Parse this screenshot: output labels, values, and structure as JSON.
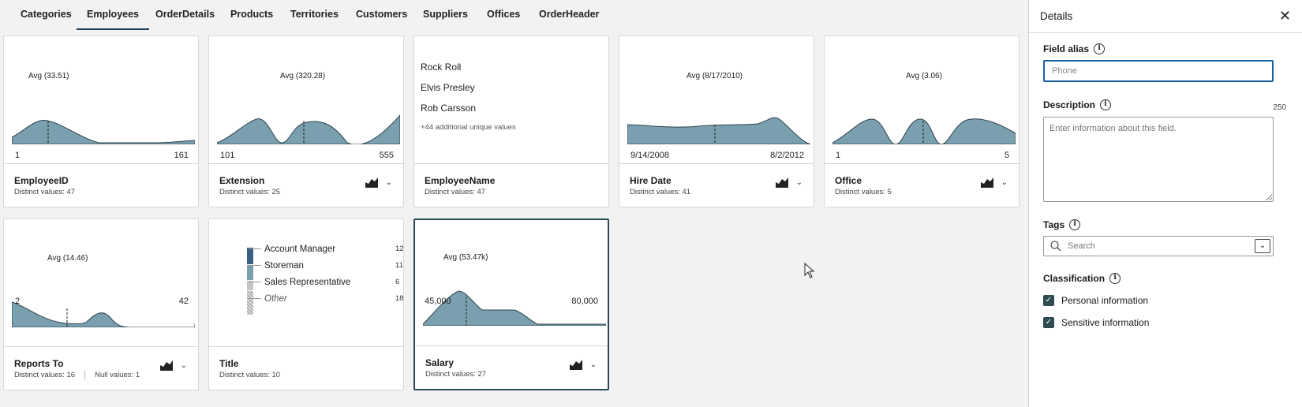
{
  "tabs": [
    "Categories",
    "Employees",
    "OrderDetails",
    "Products",
    "Territories",
    "Customers",
    "Suppliers",
    "Offices",
    "OrderHeader"
  ],
  "active_tab": "Employees",
  "cards": {
    "employee_id": {
      "name": "EmployeeID",
      "distinct": "Distinct values: 47",
      "avg": "Avg (33.51)",
      "min": "1",
      "max": "161"
    },
    "extension": {
      "name": "Extension",
      "distinct": "Distinct values: 25",
      "avg": "Avg (320.28)",
      "min": "101",
      "max": "555"
    },
    "employee_name": {
      "name": "EmployeeName",
      "distinct": "Distinct values: 47",
      "values": [
        "Rock Roll",
        "Elvis Presley",
        "Rob Carsson"
      ],
      "more": "+44 additional unique values"
    },
    "hire_date": {
      "name": "Hire Date",
      "distinct": "Distinct values: 41",
      "avg": "Avg (8/17/2010)",
      "min": "9/14/2008",
      "max": "8/2/2012"
    },
    "office": {
      "name": "Office",
      "distinct": "Distinct values: 5",
      "avg": "Avg (3.06)",
      "min": "1",
      "max": "5"
    },
    "reports_to": {
      "name": "Reports To",
      "distinct": "Distinct values: 16",
      "nulls": "Null values: 1",
      "avg": "Avg (14.46)",
      "min": "2",
      "max": "42"
    },
    "title": {
      "name": "Title",
      "distinct": "Distinct values: 10",
      "legend": [
        {
          "label": "Account Manager",
          "count": "12"
        },
        {
          "label": "Storeman",
          "count": "11"
        },
        {
          "label": "Sales Representative",
          "count": "6"
        },
        {
          "label": "Other",
          "count": "18"
        }
      ]
    },
    "salary": {
      "name": "Salary",
      "distinct": "Distinct values: 27",
      "avg": "Avg (53.47k)",
      "min": "45,000",
      "max": "80,000"
    }
  },
  "details": {
    "title": "Details",
    "field_alias_label": "Field alias",
    "field_alias_placeholder": "Phone",
    "description_label": "Description",
    "char_count": "250",
    "description_placeholder": "Enter information about this field.",
    "tags_label": "Tags",
    "tags_placeholder": "Search",
    "classification_label": "Classification",
    "checkboxes": [
      {
        "label": "Personal information",
        "checked": true
      },
      {
        "label": "Sensitive information",
        "checked": true
      }
    ]
  },
  "colors": {
    "dist_fill": "#7a9fae",
    "dist_stroke": "#2f4550",
    "accent": "#1d5fa5",
    "selected_border": "#2b4a57"
  }
}
